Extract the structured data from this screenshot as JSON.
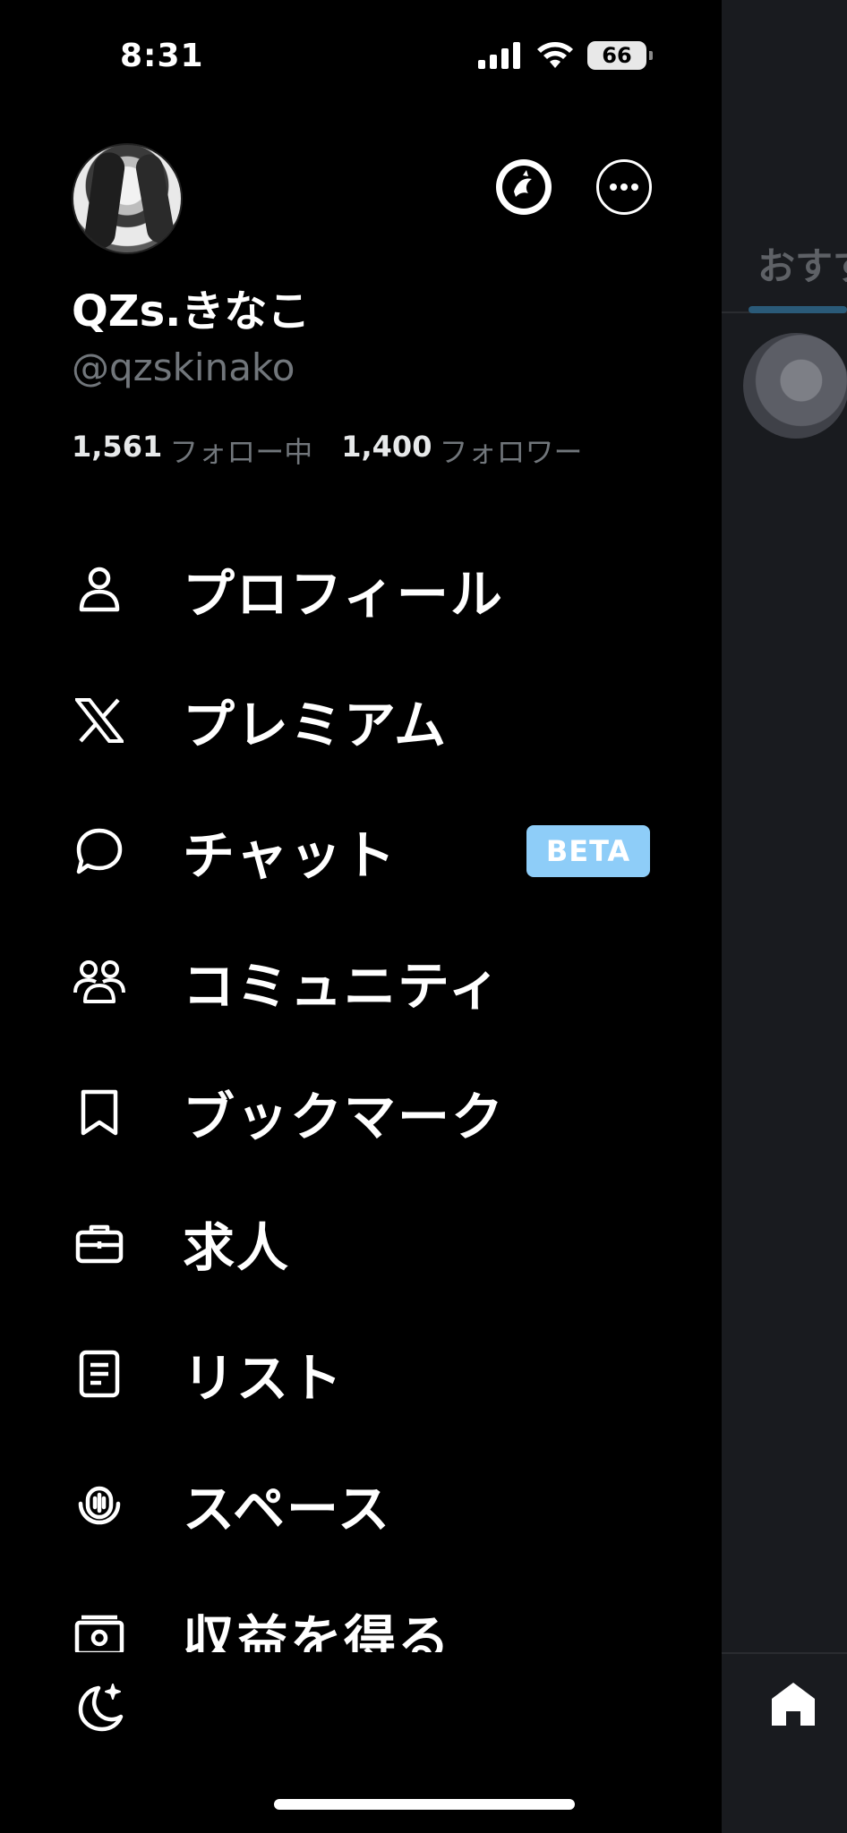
{
  "status_bar": {
    "time": "8:31",
    "battery": "66",
    "icons": [
      "signal-icon",
      "wifi-icon",
      "battery-icon"
    ]
  },
  "profile": {
    "display_name": "QZs.きなこ",
    "handle": "@qzskinako",
    "following_count": "1,561",
    "following_label": "フォロー中",
    "followers_count": "1,400",
    "followers_label": "フォロワー"
  },
  "menu": {
    "items": [
      {
        "label": "プロフィール",
        "icon": "person-icon"
      },
      {
        "label": "プレミアム",
        "icon": "x-logo-icon"
      },
      {
        "label": "チャット",
        "icon": "chat-bubble-icon",
        "badge": "BETA"
      },
      {
        "label": "コミュニティ",
        "icon": "communities-icon"
      },
      {
        "label": "ブックマーク",
        "icon": "bookmark-icon"
      },
      {
        "label": "求人",
        "icon": "briefcase-icon"
      },
      {
        "label": "リスト",
        "icon": "list-icon"
      },
      {
        "label": "スペース",
        "icon": "spaces-mic-icon"
      },
      {
        "label": "収益を得る",
        "icon": "money-icon"
      }
    ]
  },
  "background_timeline": {
    "tab_label": "おすす"
  },
  "colors": {
    "background": "#000000",
    "text": "#ffffff",
    "secondary_text": "#71767b",
    "beta_badge": "#8ecdf8",
    "peek_background": "#191b1f"
  }
}
